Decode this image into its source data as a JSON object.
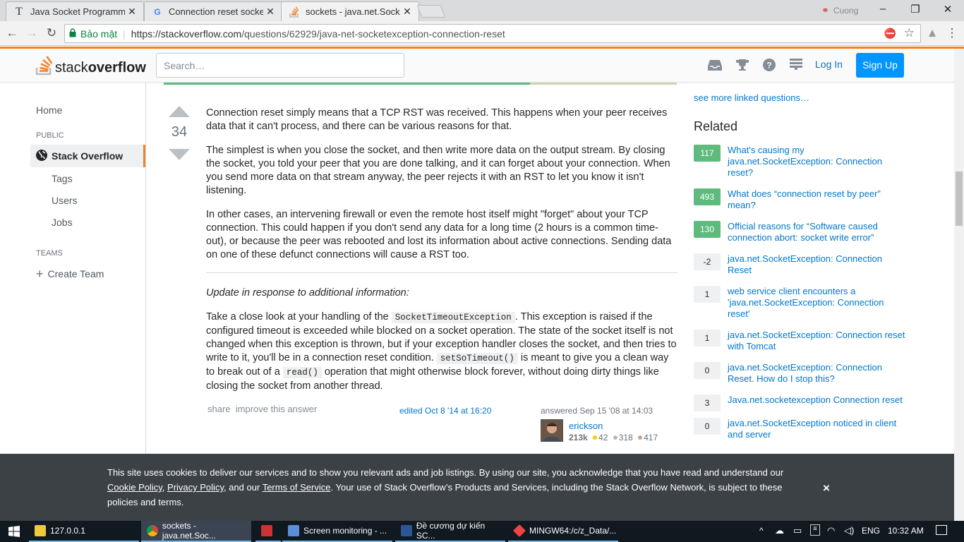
{
  "browser": {
    "tabs": [
      {
        "label": "Java Socket Programming",
        "icon": "T"
      },
      {
        "label": "Connection reset socket j",
        "icon": "G"
      },
      {
        "label": "sockets - java.net.SocketE",
        "icon": "so"
      }
    ],
    "profile_name": "Cuong",
    "secure_label": "Bảo mật",
    "url_host": "https://stackoverflow.com",
    "url_path": "/questions/62929/java-net-socketexception-connection-reset"
  },
  "so_header": {
    "logo_light": "stack",
    "logo_bold": "overflow",
    "search_placeholder": "Search…",
    "login": "Log In",
    "signup": "Sign Up"
  },
  "left_nav": {
    "home": "Home",
    "public": "PUBLIC",
    "stack_overflow": "Stack Overflow",
    "tags": "Tags",
    "users": "Users",
    "jobs": "Jobs",
    "teams": "TEAMS",
    "create_team": "Create Team"
  },
  "answer": {
    "score": "34",
    "p1": "Connection reset simply means that a TCP RST was received. This happens when your peer receives data that it can't process, and there can be various reasons for that.",
    "p2": "The simplest is when you close the socket, and then write more data on the output stream. By closing the socket, you told your peer that you are done talking, and it can forget about your connection. When you send more data on that stream anyway, the peer rejects it with an RST to let you know it isn't listening.",
    "p3": "In other cases, an intervening firewall or even the remote host itself might \"forget\" about your TCP connection. This could happen if you don't send any data for a long time (2 hours is a common time-out), or because the peer was rebooted and lost its information about active connections. Sending data on one of these defunct connections will cause a RST too.",
    "update": "Update in response to additional information:",
    "p5a": "Take a close look at your handling of the ",
    "code1": "SocketTimeoutException",
    "p5b": ". This exception is raised if the configured timeout is exceeded while blocked on a socket operation. The state of the socket itself is not changed when this exception is thrown, but if your exception handler closes the socket, and then tries to write to it, you'll be in a connection reset condition. ",
    "code2": "setSoTimeout()",
    "p5c": " is meant to give you a clean way to break out of a ",
    "code3": "read()",
    "p5d": " operation that might otherwise block forever, without doing dirty things like closing the socket from another thread.",
    "share": "share",
    "improve": "improve this answer",
    "edited": "edited Oct 8 '14 at 16:20",
    "answered": "answered Sep 15 '08 at 14:03",
    "user": "erickson",
    "rep": "213k",
    "gold": "42",
    "silver": "318",
    "bronze": "417"
  },
  "sidebar": {
    "see_more": "see more linked questions…",
    "related_heading": "Related",
    "related": [
      {
        "score": "117",
        "accepted": true,
        "title": "What's causing my java.net.SocketException: Connection reset?"
      },
      {
        "score": "493",
        "accepted": true,
        "title": "What does “connection reset by peer” mean?"
      },
      {
        "score": "130",
        "accepted": true,
        "title": "Official reasons for “Software caused connection abort: socket write error”"
      },
      {
        "score": "-2",
        "accepted": false,
        "title": "java.net.SocketException: Connection Reset"
      },
      {
        "score": "1",
        "accepted": false,
        "title": "web service client encounters a 'java.net.SocketException: Connection reset'"
      },
      {
        "score": "1",
        "accepted": false,
        "title": "java.net.SocketException: Connection reset with Tomcat"
      },
      {
        "score": "0",
        "accepted": false,
        "title": "java.net.SocketException: Connection Reset. How do I stop this?"
      },
      {
        "score": "3",
        "accepted": false,
        "title": "Java.net.socketexception Connection reset"
      },
      {
        "score": "0",
        "accepted": false,
        "title": "java.net.SocketException noticed in client and server"
      }
    ]
  },
  "cookie": {
    "text1": "This site uses cookies to deliver our services and to show you relevant ads and job listings. By using our site, you acknowledge that you have read and understand our ",
    "cookie_policy": "Cookie Policy",
    "sep1": ", ",
    "privacy_policy": "Privacy Policy",
    "sep2": ", and our ",
    "terms": "Terms of Service",
    "text2": ". Your use of Stack Overflow’s Products and Services, including the Stack Overflow Network, is subject to these policies and terms.",
    "close": "×"
  },
  "taskbar": {
    "items": [
      {
        "label": "127.0.0.1"
      },
      {
        "label": "sockets - java.net.Soc..."
      },
      {
        "label": ""
      },
      {
        "label": "Screen monitoring - ..."
      },
      {
        "label": "Đề cương dự kiến SC..."
      },
      {
        "label": "MINGW64:/c/z_Data/..."
      }
    ],
    "lang": "ENG",
    "time": "10:32 AM"
  },
  "colors": {
    "so_orange": "#f48024",
    "accepted_green": "#5eba7d",
    "link_blue": "#0077cc",
    "signup_blue": "#0095ff"
  }
}
